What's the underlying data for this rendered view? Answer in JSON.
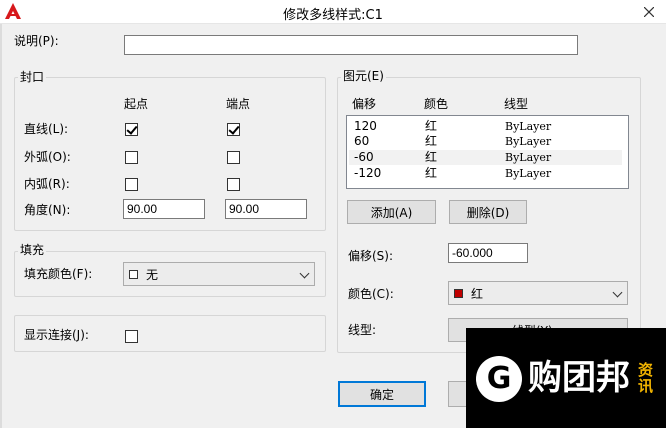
{
  "window": {
    "title": "修改多线样式:C1"
  },
  "description": {
    "label": "说明(P):",
    "value": ""
  },
  "caps": {
    "group_label": "封口",
    "col_start": "起点",
    "col_end": "端点",
    "rows": [
      {
        "label": "直线(L):",
        "start_checked": true,
        "end_checked": true
      },
      {
        "label": "外弧(O):",
        "start_checked": false,
        "end_checked": false
      },
      {
        "label": "内弧(R):",
        "start_checked": false,
        "end_checked": false
      }
    ],
    "angle": {
      "label": "角度(N):",
      "start": "90.00",
      "end": "90.00"
    }
  },
  "fill": {
    "group_label": "填充",
    "color_label": "填充颜色(F):",
    "color_value": "无",
    "swatch_color": "#ffffff"
  },
  "display_joints": {
    "label": "显示连接(J):",
    "checked": false
  },
  "elements": {
    "group_label": "图元(E)",
    "columns": [
      "偏移",
      "颜色",
      "线型"
    ],
    "rows": [
      {
        "offset": "120",
        "color": "红",
        "linetype": "ByLayer"
      },
      {
        "offset": "60",
        "color": "红",
        "linetype": "ByLayer"
      },
      {
        "offset": "-60",
        "color": "红",
        "linetype": "ByLayer"
      },
      {
        "offset": "-120",
        "color": "红",
        "linetype": "ByLayer"
      }
    ],
    "selected_row": 2,
    "add_label": "添加(A)",
    "delete_label": "删除(D)",
    "offset_label": "偏移(S):",
    "offset_value": "-60.000",
    "color_label": "颜色(C):",
    "color_value": "红",
    "color_swatch": "#c00000",
    "linetype_label": "线型:",
    "linetype_button_label": "线型(Y)..."
  },
  "buttons": {
    "ok_label": "确定"
  },
  "watermark": {
    "text": "购团邦",
    "side_text": "资讯",
    "logo_letter": "G"
  },
  "colors": {
    "accent": "#0078d7",
    "red": "#c00000",
    "app_icon": "#d7191c"
  }
}
